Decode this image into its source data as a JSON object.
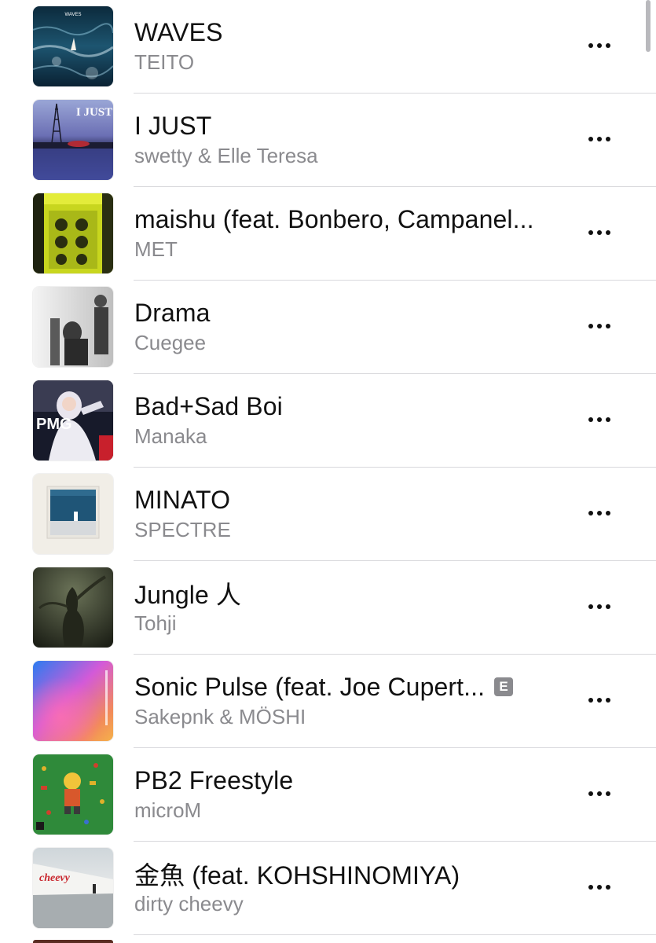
{
  "tracks": [
    {
      "title": "WAVES",
      "artist": "TEITO",
      "explicit": false,
      "artwork": "waves-artwork"
    },
    {
      "title": "I JUST",
      "artist": "swetty & Elle Teresa",
      "explicit": false,
      "artwork": "i-just-artwork"
    },
    {
      "title": "maishu (feat. Bonbero, Campanel...",
      "artist": "MET",
      "explicit": false,
      "artwork": "maishu-artwork"
    },
    {
      "title": "Drama",
      "artist": "Cuegee",
      "explicit": false,
      "artwork": "drama-artwork"
    },
    {
      "title": "Bad+Sad Boi",
      "artist": "Manaka",
      "explicit": false,
      "artwork": "bad-sad-boi-artwork"
    },
    {
      "title": "MINATO",
      "artist": "SPECTRE",
      "explicit": false,
      "artwork": "minato-artwork"
    },
    {
      "title": "Jungle 人",
      "artist": "Tohji",
      "explicit": false,
      "artwork": "jungle-artwork"
    },
    {
      "title": "Sonic Pulse (feat. Joe Cupert...",
      "artist": "Sakepnk & MÖSHI",
      "explicit": true,
      "artwork": "sonic-pulse-artwork"
    },
    {
      "title": "PB2 Freestyle",
      "artist": "microM",
      "explicit": false,
      "artwork": "pb2-freestyle-artwork"
    },
    {
      "title": "金魚 (feat. KOHSHINOMIYA)",
      "artist": "dirty cheevy",
      "explicit": false,
      "artwork": "kingyo-artwork"
    }
  ],
  "artwork_text": {
    "waves": "WAVES",
    "i_just": "I JUST",
    "bad_sad_boi": "PMG",
    "kingyo": "cheevy"
  },
  "explicit_label": "E",
  "icons": {
    "more": "ellipsis-icon"
  },
  "colors": {
    "title": "#111111",
    "subtitle": "#8a8a8e",
    "separator": "#d8d8dc",
    "explicit_badge": "#8a8a8e",
    "background": "#ffffff"
  }
}
